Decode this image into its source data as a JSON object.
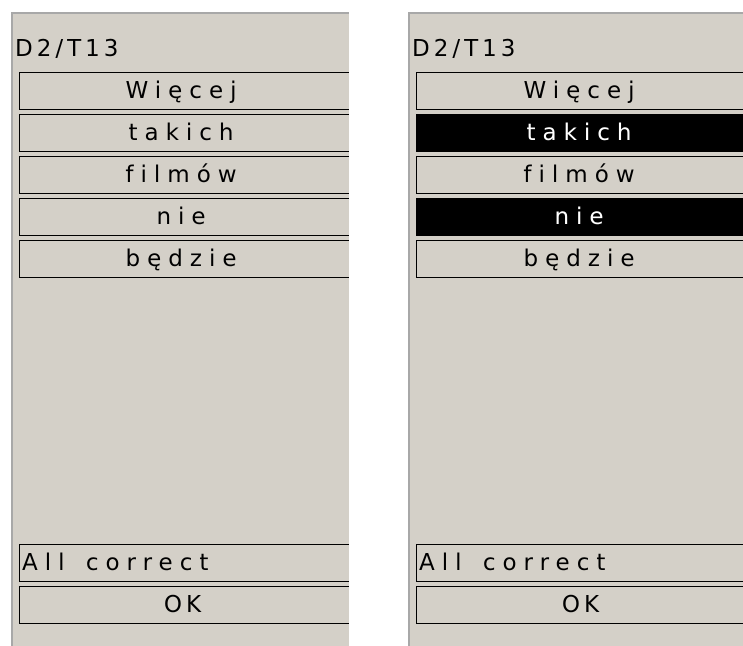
{
  "panels": [
    {
      "title": "D2/T13",
      "words": [
        {
          "text": "Więcej",
          "selected": false
        },
        {
          "text": "takich",
          "selected": false
        },
        {
          "text": "filmów",
          "selected": false
        },
        {
          "text": "nie",
          "selected": false
        },
        {
          "text": "będzie",
          "selected": false
        }
      ],
      "status": "All correct",
      "ok_label": "OK"
    },
    {
      "title": "D2/T13",
      "words": [
        {
          "text": "Więcej",
          "selected": false
        },
        {
          "text": "takich",
          "selected": true
        },
        {
          "text": "filmów",
          "selected": false
        },
        {
          "text": "nie",
          "selected": true
        },
        {
          "text": "będzie",
          "selected": false
        }
      ],
      "status": "All correct",
      "ok_label": "OK"
    }
  ],
  "colors": {
    "panel_background": "#d4d0c8",
    "selected_background": "#000000",
    "selected_text": "#ffffff"
  }
}
